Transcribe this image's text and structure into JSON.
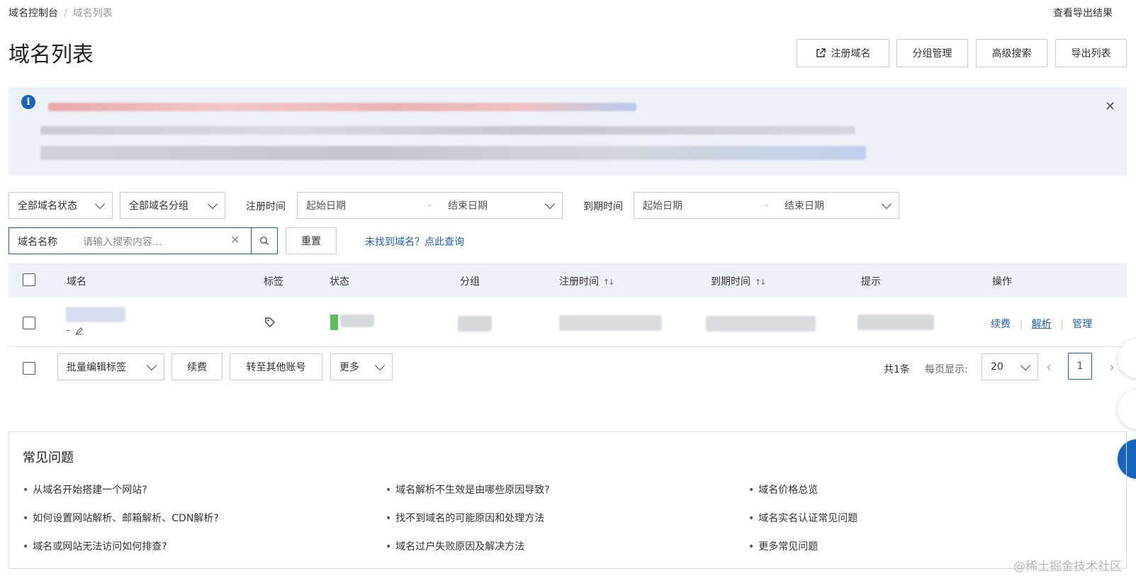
{
  "breadcrumb": {
    "root": "域名控制台",
    "separator": "/",
    "current": "域名列表"
  },
  "header": {
    "export_results": "查看导出结果",
    "title": "域名列表",
    "buttons": {
      "register": "注册域名",
      "group": "分组管理",
      "advanced": "高级搜索",
      "export": "导出列表"
    }
  },
  "filters": {
    "status": "全部域名状态",
    "group": "全部域名分组",
    "reg_time_label": "注册时间",
    "exp_time_label": "到期时间",
    "start_placeholder": "起始日期",
    "end_placeholder": "结束日期",
    "range_sep": "-",
    "search_field": "域名名称",
    "search_placeholder": "请输入搜索内容...",
    "reset": "重置",
    "not_found_link": "未找到域名？点此查询"
  },
  "table": {
    "columns": {
      "domain": "域名",
      "tags": "标签",
      "status": "状态",
      "group": "分组",
      "reg_time": "注册时间",
      "exp_time": "到期时间",
      "hint": "提示",
      "actions": "操作"
    },
    "sort_glyph": "↑↓",
    "row": {
      "domain_sub": "-",
      "actions": {
        "renew": "续费",
        "dns": "解析",
        "manage": "管理"
      }
    }
  },
  "bulk": {
    "edit_tags": "批量编辑标签",
    "renew": "续费",
    "transfer": "转至其他账号",
    "more": "更多",
    "total": "共1条",
    "per_page_label": "每页显示:",
    "per_page": "20",
    "page": "1"
  },
  "faq": {
    "title": "常见问题",
    "col1": [
      "从域名开始搭建一个网站?",
      "如何设置网站解析、邮箱解析、CDN解析?",
      "域名或网站无法访问如何排查?"
    ],
    "col2": [
      "域名解析不生效是由哪些原因导致?",
      "找不到域名的可能原因和处理方法",
      "域名过户失败原因及解决方法"
    ],
    "col3": [
      "域名价格总览",
      "域名实名认证常见问题",
      "更多常见问题"
    ]
  },
  "watermark": "@稀土掘金技术社区",
  "colors": {
    "accent": "#1e5fb4",
    "notice_bg": "#eef2f8",
    "info_icon": "#1565c0"
  }
}
